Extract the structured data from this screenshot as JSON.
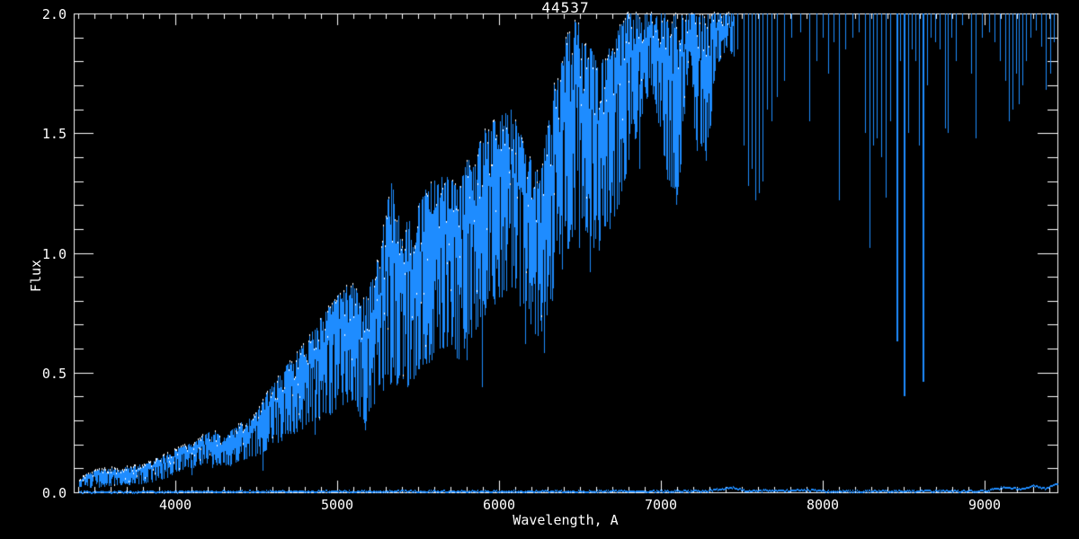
{
  "figure": {
    "background_color": "#000000",
    "axis_color": "#ffffff",
    "line_color": "#1e8cff",
    "tip_color": "#ffffff"
  },
  "chart_data": {
    "type": "line",
    "title": "44537",
    "xlabel": "Wavelength, A",
    "ylabel": "Flux",
    "xlim": [
      3372,
      9450
    ],
    "ylim": [
      0.0,
      2.0
    ],
    "xticks": [
      4000,
      5000,
      6000,
      7000,
      8000,
      9000
    ],
    "yticks": [
      0.0,
      0.5,
      1.0,
      1.5,
      2.0
    ],
    "x_minor_step": 100,
    "y_minor_step": 0.1,
    "grid": false,
    "legend": "none",
    "description": "Noisy stellar spectrum rising from ~0 flux at 3400A, clipped at flux 2.0 beyond ~6800A, with telluric/stellar absorption spikes in the red and a near-zero baseline trace",
    "series": [
      {
        "name": "spectrum-envelope",
        "style": "vertical-noise-band",
        "points": [
          [
            3406,
            0.01,
            0.05
          ],
          [
            3450,
            0.02,
            0.08
          ],
          [
            3550,
            0.02,
            0.1
          ],
          [
            3650,
            0.03,
            0.1
          ],
          [
            3750,
            0.03,
            0.11
          ],
          [
            3850,
            0.04,
            0.13
          ],
          [
            3950,
            0.06,
            0.16
          ],
          [
            4000,
            0.08,
            0.18
          ],
          [
            4110,
            0.1,
            0.21
          ],
          [
            4220,
            0.12,
            0.26
          ],
          [
            4300,
            0.1,
            0.23
          ],
          [
            4390,
            0.13,
            0.29
          ],
          [
            4470,
            0.14,
            0.31
          ],
          [
            4580,
            0.18,
            0.43
          ],
          [
            4670,
            0.22,
            0.52
          ],
          [
            4750,
            0.25,
            0.58
          ],
          [
            4830,
            0.28,
            0.66
          ],
          [
            4920,
            0.3,
            0.75
          ],
          [
            5000,
            0.35,
            0.82
          ],
          [
            5080,
            0.38,
            0.88
          ],
          [
            5170,
            0.28,
            0.8
          ],
          [
            5250,
            0.4,
            0.98
          ],
          [
            5330,
            0.45,
            1.3
          ],
          [
            5420,
            0.42,
            1.12
          ],
          [
            5500,
            0.5,
            1.22
          ],
          [
            5580,
            0.55,
            1.3
          ],
          [
            5670,
            0.6,
            1.33
          ],
          [
            5750,
            0.55,
            1.27
          ],
          [
            5830,
            0.65,
            1.45
          ],
          [
            5920,
            0.75,
            1.52
          ],
          [
            6000,
            0.8,
            1.57
          ],
          [
            6080,
            0.85,
            1.6
          ],
          [
            6170,
            0.7,
            1.42
          ],
          [
            6250,
            0.62,
            1.32
          ],
          [
            6330,
            0.8,
            1.68
          ],
          [
            6420,
            1.0,
            1.92
          ],
          [
            6470,
            1.1,
            1.97
          ],
          [
            6530,
            1.05,
            1.92
          ],
          [
            6610,
            1.0,
            1.78
          ],
          [
            6700,
            1.1,
            1.88
          ],
          [
            6780,
            1.3,
            2.0
          ],
          [
            6870,
            1.55,
            2.0
          ],
          [
            6940,
            1.7,
            2.0
          ],
          [
            6980,
            1.55,
            2.0
          ],
          [
            7020,
            1.38,
            2.0
          ],
          [
            7060,
            1.22,
            2.0
          ],
          [
            7090,
            1.17,
            2.0
          ],
          [
            7120,
            1.35,
            2.0
          ],
          [
            7150,
            1.62,
            2.0
          ],
          [
            7175,
            1.8,
            2.0
          ],
          [
            7200,
            1.55,
            2.0
          ],
          [
            7230,
            1.38,
            2.0
          ],
          [
            7260,
            1.45,
            2.0
          ],
          [
            7290,
            1.3,
            2.0
          ],
          [
            7320,
            1.7,
            2.0
          ],
          [
            7360,
            1.8,
            2.0
          ],
          [
            7410,
            1.85,
            2.0
          ],
          [
            7450,
            1.82,
            2.0
          ]
        ]
      },
      {
        "name": "absorption-spikes",
        "style": "vertical-line-from-top",
        "points": [
          [
            7333,
            1.85
          ],
          [
            7361,
            1.8
          ],
          [
            7394,
            1.9
          ],
          [
            7433,
            1.88
          ],
          [
            7472,
            1.85
          ],
          [
            7511,
            1.45
          ],
          [
            7539,
            1.28
          ],
          [
            7561,
            1.35
          ],
          [
            7583,
            1.22
          ],
          [
            7606,
            1.25
          ],
          [
            7628,
            1.3
          ],
          [
            7656,
            1.6
          ],
          [
            7683,
            1.55
          ],
          [
            7717,
            1.65
          ],
          [
            7761,
            1.72
          ],
          [
            7806,
            1.9
          ],
          [
            7861,
            1.92
          ],
          [
            7917,
            1.55
          ],
          [
            7961,
            1.8
          ],
          [
            8000,
            1.9
          ],
          [
            8033,
            1.75
          ],
          [
            8067,
            1.88
          ],
          [
            8100,
            1.22
          ],
          [
            8139,
            1.85
          ],
          [
            8183,
            1.9
          ],
          [
            8222,
            1.92
          ],
          [
            8261,
            1.5
          ],
          [
            8289,
            1.02
          ],
          [
            8311,
            1.45
          ],
          [
            8333,
            1.48
          ],
          [
            8361,
            1.4
          ],
          [
            8389,
            1.23
          ],
          [
            8417,
            1.55
          ],
          [
            8456,
            0.63
          ],
          [
            8478,
            1.8
          ],
          [
            8500,
            0.4
          ],
          [
            8528,
            1.5
          ],
          [
            8550,
            1.85
          ],
          [
            8572,
            1.8
          ],
          [
            8594,
            1.45
          ],
          [
            8617,
            0.46
          ],
          [
            8644,
            1.7
          ],
          [
            8667,
            1.9
          ],
          [
            8694,
            1.88
          ],
          [
            8722,
            1.85
          ],
          [
            8756,
            1.52
          ],
          [
            8772,
            1.5
          ],
          [
            8794,
            1.9
          ],
          [
            8822,
            1.8
          ],
          [
            8861,
            1.95
          ],
          [
            8917,
            1.75
          ],
          [
            8944,
            1.48
          ],
          [
            8983,
            1.9
          ],
          [
            9028,
            1.92
          ],
          [
            9061,
            1.88
          ],
          [
            9094,
            1.8
          ],
          [
            9128,
            1.72
          ],
          [
            9150,
            1.55
          ],
          [
            9172,
            1.6
          ],
          [
            9194,
            1.75
          ],
          [
            9211,
            1.62
          ],
          [
            9233,
            1.7
          ],
          [
            9256,
            1.8
          ],
          [
            9283,
            1.9
          ],
          [
            9317,
            1.93
          ],
          [
            9350,
            1.86
          ],
          [
            9378,
            1.68
          ],
          [
            9406,
            1.75
          ],
          [
            9428,
            1.88
          ]
        ]
      },
      {
        "name": "deep-dips",
        "style": "narrow-dip-below-band",
        "points": [
          [
            4101,
            0.07
          ],
          [
            4226,
            0.1
          ],
          [
            4340,
            0.11
          ],
          [
            4540,
            0.09
          ],
          [
            4861,
            0.24
          ],
          [
            5170,
            0.26
          ],
          [
            5260,
            0.45
          ],
          [
            5800,
            0.55
          ],
          [
            5893,
            0.44
          ],
          [
            6160,
            0.62
          ],
          [
            6280,
            0.58
          ],
          [
            6495,
            1.02
          ],
          [
            6563,
            0.92
          ],
          [
            6620,
            1.05
          ],
          [
            6867,
            1.35
          ]
        ]
      },
      {
        "name": "baseline-trace",
        "style": "thin-line",
        "points": [
          [
            3406,
            0.008
          ],
          [
            4500,
            0.01
          ],
          [
            5500,
            0.01
          ],
          [
            6500,
            0.01
          ],
          [
            7280,
            0.012
          ],
          [
            7440,
            0.028
          ],
          [
            7520,
            0.012
          ],
          [
            7900,
            0.016
          ],
          [
            8050,
            0.01
          ],
          [
            8460,
            0.012
          ],
          [
            9000,
            0.012
          ],
          [
            9140,
            0.03
          ],
          [
            9220,
            0.018
          ],
          [
            9300,
            0.034
          ],
          [
            9380,
            0.022
          ],
          [
            9430,
            0.04
          ]
        ]
      }
    ]
  }
}
